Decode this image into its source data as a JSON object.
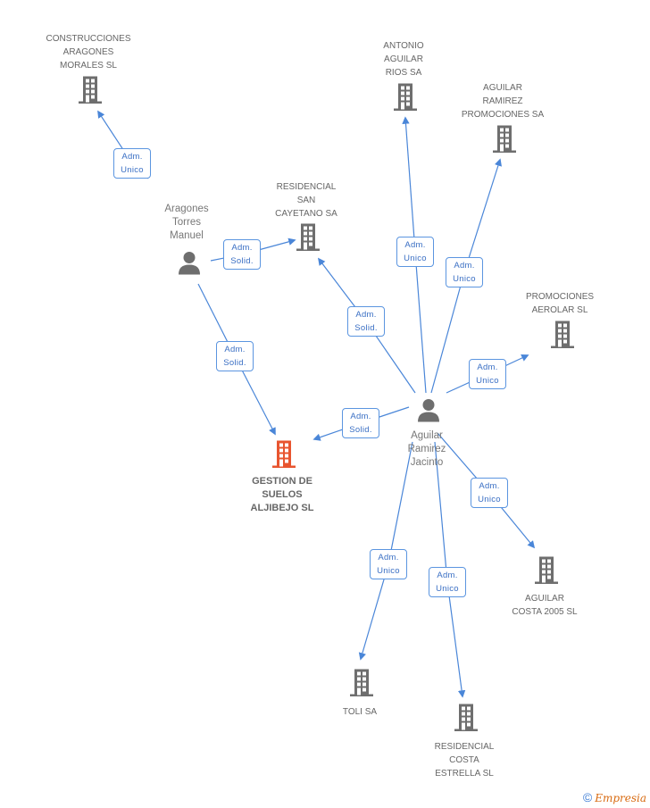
{
  "colors": {
    "edge": "#4a86d8",
    "building": "#6e6e6e",
    "main_building": "#e8552f",
    "person": "#6e6e6e"
  },
  "main_company": {
    "name_lines": [
      "GESTION DE",
      "SUELOS",
      "ALJIBEJO SL"
    ],
    "icon": "building-icon"
  },
  "persons": [
    {
      "id": "aragones",
      "name_lines": [
        "Aragones",
        "Torres",
        "Manuel"
      ],
      "icon": "person-icon"
    },
    {
      "id": "aguilar",
      "name_lines": [
        "Aguilar",
        "Ramirez",
        "Jacinto"
      ],
      "icon": "person-icon"
    }
  ],
  "companies": [
    {
      "id": "construcciones",
      "name_lines": [
        "CONSTRUCCIONES",
        "ARAGONES",
        "MORALES SL"
      ]
    },
    {
      "id": "residencial_san",
      "name_lines": [
        "RESIDENCIAL",
        "SAN",
        "CAYETANO SA"
      ]
    },
    {
      "id": "antonio",
      "name_lines": [
        "ANTONIO",
        "AGUILAR",
        "RIOS SA"
      ]
    },
    {
      "id": "aguilar_prom",
      "name_lines": [
        "AGUILAR",
        "RAMIREZ",
        "PROMOCIONES SA"
      ]
    },
    {
      "id": "aerolar",
      "name_lines": [
        "PROMOCIONES",
        "AEROLAR SL"
      ]
    },
    {
      "id": "costa2005",
      "name_lines": [
        "AGUILAR",
        "COSTA 2005 SL"
      ]
    },
    {
      "id": "toli",
      "name_lines": [
        "TOLI SA"
      ]
    },
    {
      "id": "estrella",
      "name_lines": [
        "RESIDENCIAL",
        "COSTA",
        "ESTRELLA SL"
      ]
    }
  ],
  "relations": [
    {
      "from": "aragones",
      "to": "construcciones",
      "role": [
        "Adm.",
        "Unico"
      ]
    },
    {
      "from": "aragones",
      "to": "residencial_san",
      "role": [
        "Adm.",
        "Solid."
      ]
    },
    {
      "from": "aragones",
      "to": "main",
      "role": [
        "Adm.",
        "Solid."
      ]
    },
    {
      "from": "aguilar",
      "to": "residencial_san",
      "role": [
        "Adm.",
        "Solid."
      ]
    },
    {
      "from": "aguilar",
      "to": "antonio",
      "role": [
        "Adm.",
        "Unico"
      ]
    },
    {
      "from": "aguilar",
      "to": "aguilar_prom",
      "role": [
        "Adm.",
        "Unico"
      ]
    },
    {
      "from": "aguilar",
      "to": "aerolar",
      "role": [
        "Adm.",
        "Unico"
      ]
    },
    {
      "from": "aguilar",
      "to": "main",
      "role": [
        "Adm.",
        "Solid."
      ]
    },
    {
      "from": "aguilar",
      "to": "costa2005",
      "role": [
        "Adm.",
        "Unico"
      ]
    },
    {
      "from": "aguilar",
      "to": "toli",
      "role": [
        "Adm.",
        "Unico"
      ]
    },
    {
      "from": "aguilar",
      "to": "estrella",
      "role": [
        "Adm.",
        "Unico"
      ]
    }
  ],
  "footer": {
    "copyright": "©",
    "brand": "Empresia"
  }
}
